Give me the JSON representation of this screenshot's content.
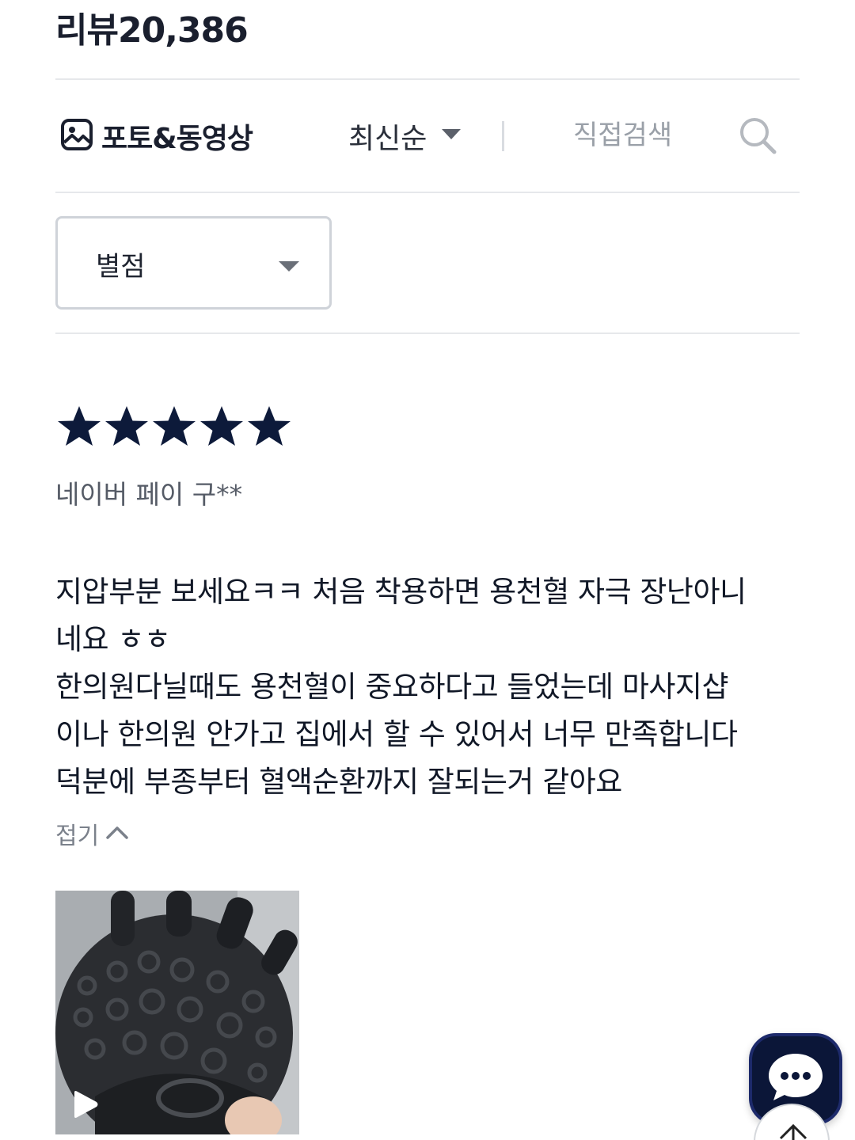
{
  "header": {
    "review_count_label": "리뷰20,386"
  },
  "filters": {
    "photo_video_label": "포토&동영상",
    "sort_label": "최신순",
    "search_placeholder": "직접검색",
    "rating_label": "별점"
  },
  "review": {
    "rating": 5,
    "rating_max": 5,
    "reviewer": "네이버 페이 구**",
    "body_lines": [
      "지압부분 보세요ㅋㅋ 처음 착용하면 용천혈 자극 장난아니",
      "네요 ㅎㅎ",
      "한의원다닐때도 용천혈이 중요하다고 들었는데 마사지샵",
      "이나 한의원 안가고 집에서 할 수 있어서 너무 만족합니다",
      "덕분에 부종부터 혈액순환까지 잘되는거 같아요"
    ],
    "collapse_label": "접기"
  },
  "colors": {
    "star": "#0d1a3a",
    "chat_fab": "#0b1638",
    "divider": "#e6e8eb"
  },
  "icons": {
    "photo_filter": "photo-icon",
    "sort": "caret-down-icon",
    "search": "search-icon",
    "collapse": "chevron-up-icon",
    "video": "play-icon",
    "chat": "chat-bubble-icon",
    "scroll_top": "arrow-up-icon"
  }
}
